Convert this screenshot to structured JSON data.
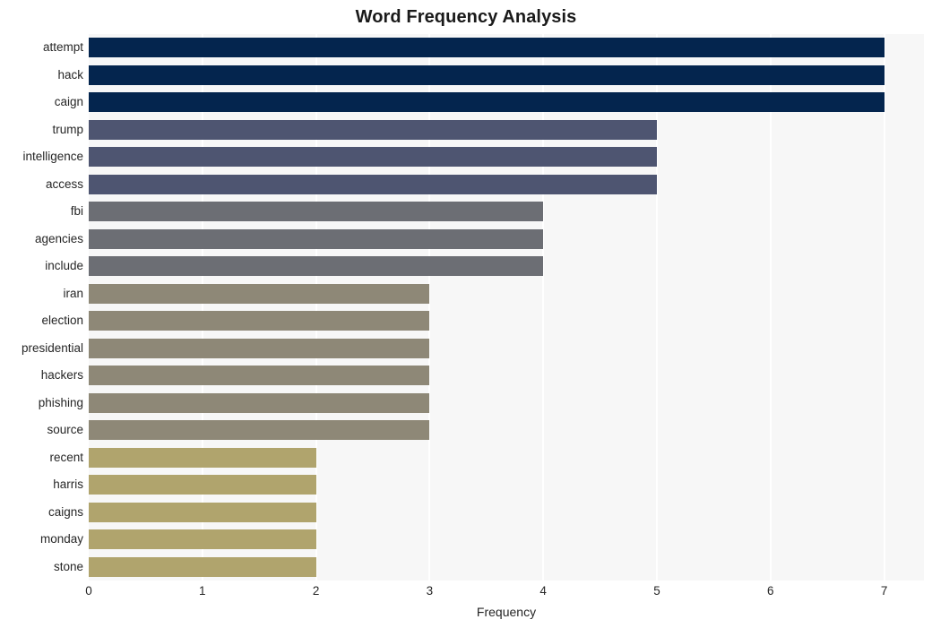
{
  "chart_data": {
    "type": "bar",
    "orientation": "horizontal",
    "title": "Word Frequency Analysis",
    "xlabel": "Frequency",
    "ylabel": "",
    "xlim": [
      0,
      7
    ],
    "ylim": null,
    "grid": true,
    "grid_axis": "x",
    "legend": false,
    "legend_position": "none",
    "x_ticks": [
      0,
      1,
      2,
      3,
      4,
      5,
      6,
      7
    ],
    "x_tick_labels": [
      "0",
      "1",
      "2",
      "3",
      "4",
      "5",
      "6",
      "7"
    ],
    "categories": [
      "attempt",
      "hack",
      "caign",
      "trump",
      "intelligence",
      "access",
      "fbi",
      "agencies",
      "include",
      "iran",
      "election",
      "presidential",
      "hackers",
      "phishing",
      "source",
      "recent",
      "harris",
      "caigns",
      "monday",
      "stone"
    ],
    "values": [
      7,
      7,
      7,
      5,
      5,
      5,
      4,
      4,
      4,
      3,
      3,
      3,
      3,
      3,
      3,
      2,
      2,
      2,
      2,
      2
    ],
    "bar_colors": [
      "#04254e",
      "#04254e",
      "#04254e",
      "#4e5571",
      "#4e5571",
      "#4e5571",
      "#6c6e74",
      "#6c6e74",
      "#6c6e74",
      "#8e8877",
      "#8e8877",
      "#8e8877",
      "#8e8877",
      "#8e8877",
      "#8e8877",
      "#b0a46d",
      "#b0a46d",
      "#b0a46d",
      "#b0a46d",
      "#b0a46d"
    ]
  },
  "style": {
    "plot_background": "#f7f7f7",
    "figure_background": "#ffffff",
    "gridline_color": "#ffffff",
    "text_color": "#262626",
    "title_color": "#1a1a1a"
  }
}
